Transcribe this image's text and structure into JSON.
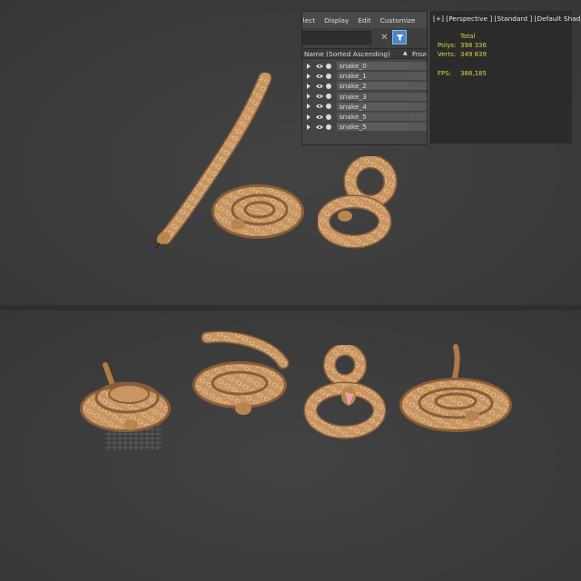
{
  "menu": [
    "elect",
    "Display",
    "Edit",
    "Customize"
  ],
  "explorer": {
    "column_name": "Name (Sorted Ascending)",
    "column_frozen": "Froze",
    "items": [
      "snake_0",
      "snake_1",
      "snake_2",
      "snake_3",
      "snake_4",
      "snake_5",
      "snake_5"
    ]
  },
  "viewport": {
    "label": "[+] [Perspective ] [Standard ] [Default Shading ]",
    "stats": {
      "total_header": "Total",
      "polys_label": "Polys:",
      "polys_value": "398 336",
      "verts_label": "Verts:",
      "verts_value": "349 839",
      "fps_label": "FPS:",
      "fps_value": "388,185"
    }
  },
  "colors": {
    "background": "#3c3c3c",
    "stats_text": "#e8d24a",
    "filter_active": "#4a86c8",
    "snake_body": "#c99563"
  }
}
